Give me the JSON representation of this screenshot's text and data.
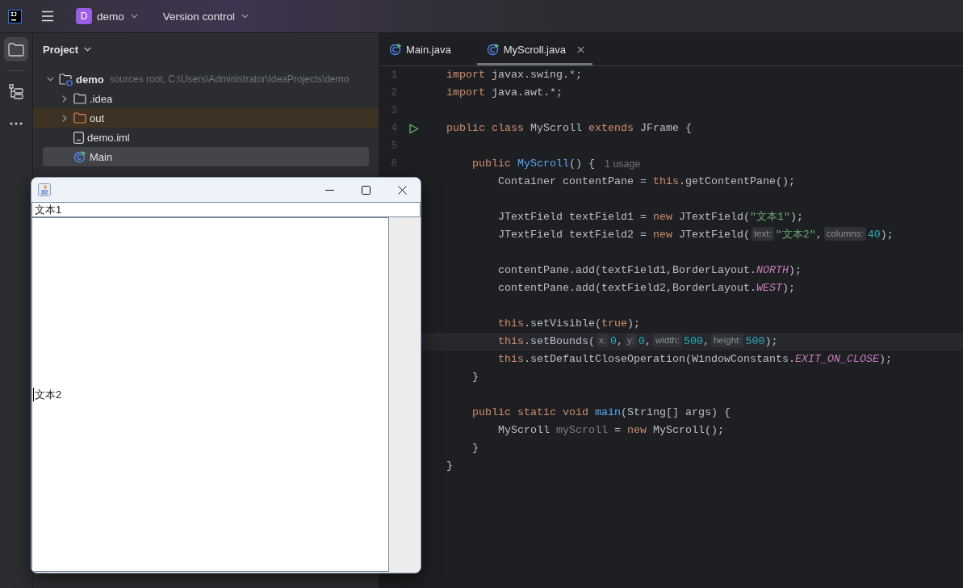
{
  "top_bar": {
    "logo": "IJ",
    "project": {
      "badge": "D",
      "name": "demo"
    },
    "vcs": "Version control"
  },
  "tool_strip": [
    {
      "kind": "project",
      "selected": true
    },
    {
      "kind": "structure",
      "selected": false
    },
    {
      "kind": "more",
      "selected": false
    }
  ],
  "project_panel": {
    "title": "Project",
    "tree": [
      {
        "label": "demo",
        "kind": "module",
        "hint": "sources root, C:\\Users\\Administrator\\IdeaProjects\\demo",
        "expanded": true,
        "selected": false,
        "excluded": false,
        "children": [
          {
            "label": ".idea",
            "kind": "folder",
            "expanded": false,
            "selected": false,
            "excluded": false
          },
          {
            "label": "out",
            "kind": "folder",
            "expanded": false,
            "selected": false,
            "excluded": true
          },
          {
            "label": "demo.iml",
            "kind": "file",
            "selected": false,
            "excluded": false
          },
          {
            "label": "Main",
            "kind": "class",
            "selected": true,
            "excluded": false
          }
        ]
      }
    ]
  },
  "editor": {
    "tabs": [
      {
        "label": "Main.java",
        "selected": false
      },
      {
        "label": "MyScroll.java",
        "selected": true
      }
    ],
    "gutter": [
      {
        "number": "1",
        "run": false
      },
      {
        "number": "2",
        "run": false
      },
      {
        "number": "3",
        "run": false
      },
      {
        "number": "4",
        "run": true
      },
      {
        "number": "5",
        "run": false
      },
      {
        "number": "6",
        "run": false
      }
    ],
    "lines": [
      {
        "current": false,
        "tokens": [
          {
            "text": "import ",
            "kind": "keyword"
          },
          {
            "text": "javax.swing.*;",
            "kind": "plain"
          }
        ]
      },
      {
        "current": false,
        "tokens": [
          {
            "text": "import ",
            "kind": "keyword"
          },
          {
            "text": "java.awt.*;",
            "kind": "plain"
          }
        ]
      },
      {
        "current": false
      },
      {
        "current": false,
        "tokens": [
          {
            "text": "public class ",
            "kind": "keyword"
          },
          {
            "text": "MyScroll ",
            "kind": "plain"
          },
          {
            "text": "extends ",
            "kind": "keyword"
          },
          {
            "text": "JFrame {",
            "kind": "plain"
          }
        ]
      },
      {
        "current": false
      },
      {
        "current": false,
        "usage": "1 usage",
        "tokens": [
          {
            "text": "    public ",
            "kind": "keyword"
          },
          {
            "text": "MyScroll",
            "kind": "decl"
          },
          {
            "text": "() {",
            "kind": "plain"
          }
        ]
      },
      {
        "current": false,
        "tokens": [
          {
            "text": "        Container contentPane = ",
            "kind": "plain"
          },
          {
            "text": "this",
            "kind": "keyword"
          },
          {
            "text": ".getContentPane();",
            "kind": "plain"
          }
        ]
      },
      {
        "current": false
      },
      {
        "current": false,
        "tokens": [
          {
            "text": "        JTextField textField1 = ",
            "kind": "plain"
          },
          {
            "text": "new ",
            "kind": "keyword"
          },
          {
            "text": "JTextField(",
            "kind": "plain"
          },
          {
            "text": "\"文本1\"",
            "kind": "string"
          },
          {
            "text": ");",
            "kind": "plain"
          }
        ]
      },
      {
        "current": false,
        "tokens": [
          {
            "text": "        JTextField textField2 = ",
            "kind": "plain"
          },
          {
            "text": "new ",
            "kind": "keyword"
          },
          {
            "text": "JTextField(",
            "kind": "plain"
          },
          {
            "text": "text:",
            "kind": "hint"
          },
          {
            "text": "\"文本2\"",
            "kind": "string"
          },
          {
            "text": ",",
            "kind": "plain"
          },
          {
            "text": "columns:",
            "kind": "hint"
          },
          {
            "text": "40",
            "kind": "number"
          },
          {
            "text": ");",
            "kind": "plain"
          }
        ]
      },
      {
        "current": false
      },
      {
        "current": false,
        "tokens": [
          {
            "text": "        contentPane.add(textField1,BorderLayout.",
            "kind": "plain"
          },
          {
            "text": "NORTH",
            "kind": "constant"
          },
          {
            "text": ");",
            "kind": "plain"
          }
        ]
      },
      {
        "current": false,
        "tokens": [
          {
            "text": "        contentPane.add(textField2,BorderLayout.",
            "kind": "plain"
          },
          {
            "text": "WEST",
            "kind": "constant"
          },
          {
            "text": ");",
            "kind": "plain"
          }
        ]
      },
      {
        "current": false
      },
      {
        "current": false,
        "tokens": [
          {
            "text": "        this",
            "kind": "keyword"
          },
          {
            "text": ".setVisible(",
            "kind": "plain"
          },
          {
            "text": "true",
            "kind": "keyword"
          },
          {
            "text": ");",
            "kind": "plain"
          }
        ]
      },
      {
        "current": true,
        "tokens": [
          {
            "text": "        this",
            "kind": "keyword"
          },
          {
            "text": ".setBounds(",
            "kind": "plain"
          },
          {
            "text": "x:",
            "kind": "hint"
          },
          {
            "text": "0",
            "kind": "number"
          },
          {
            "text": ",",
            "kind": "plain"
          },
          {
            "text": "y:",
            "kind": "hint"
          },
          {
            "text": "0",
            "kind": "number"
          },
          {
            "text": ",",
            "kind": "plain"
          },
          {
            "text": "width:",
            "kind": "hint"
          },
          {
            "text": "500",
            "kind": "number"
          },
          {
            "text": ",",
            "kind": "plain"
          },
          {
            "text": "height:",
            "kind": "hint"
          },
          {
            "text": "500",
            "kind": "number"
          },
          {
            "text": ");",
            "kind": "plain"
          }
        ]
      },
      {
        "current": false,
        "tokens": [
          {
            "text": "        this",
            "kind": "keyword"
          },
          {
            "text": ".setDefaultCloseOperation(WindowConstants.",
            "kind": "plain"
          },
          {
            "text": "EXIT_ON_CLOSE",
            "kind": "constant"
          },
          {
            "text": ");",
            "kind": "plain"
          }
        ]
      },
      {
        "current": false,
        "tokens": [
          {
            "text": "    }",
            "kind": "plain"
          }
        ]
      },
      {
        "current": false
      },
      {
        "current": false,
        "tokens": [
          {
            "text": "    public static void ",
            "kind": "keyword"
          },
          {
            "text": "main",
            "kind": "decl"
          },
          {
            "text": "(String[] args) {",
            "kind": "plain"
          }
        ]
      },
      {
        "current": false,
        "tokens": [
          {
            "text": "        MyScroll ",
            "kind": "plain"
          },
          {
            "text": "myScroll",
            "kind": "unused"
          },
          {
            "text": " = ",
            "kind": "plain"
          },
          {
            "text": "new ",
            "kind": "keyword"
          },
          {
            "text": "MyScroll();",
            "kind": "plain"
          }
        ]
      },
      {
        "current": false,
        "tokens": [
          {
            "text": "    }",
            "kind": "plain"
          }
        ]
      },
      {
        "current": false,
        "tokens": [
          {
            "text": "}",
            "kind": "plain"
          }
        ]
      }
    ]
  },
  "swing_window": {
    "fields": [
      {
        "value": "文本1",
        "focused": false
      },
      {
        "value": "文本2",
        "focused": true
      }
    ]
  }
}
